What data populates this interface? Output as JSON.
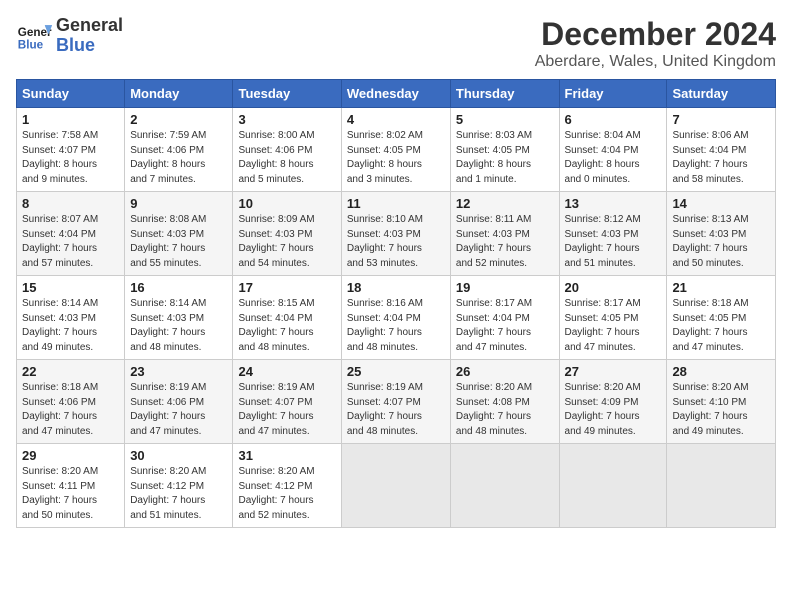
{
  "header": {
    "logo_line1": "General",
    "logo_line2": "Blue",
    "month": "December 2024",
    "location": "Aberdare, Wales, United Kingdom"
  },
  "weekdays": [
    "Sunday",
    "Monday",
    "Tuesday",
    "Wednesday",
    "Thursday",
    "Friday",
    "Saturday"
  ],
  "weeks": [
    [
      {
        "day": "1",
        "info": "Sunrise: 7:58 AM\nSunset: 4:07 PM\nDaylight: 8 hours\nand 9 minutes."
      },
      {
        "day": "2",
        "info": "Sunrise: 7:59 AM\nSunset: 4:06 PM\nDaylight: 8 hours\nand 7 minutes."
      },
      {
        "day": "3",
        "info": "Sunrise: 8:00 AM\nSunset: 4:06 PM\nDaylight: 8 hours\nand 5 minutes."
      },
      {
        "day": "4",
        "info": "Sunrise: 8:02 AM\nSunset: 4:05 PM\nDaylight: 8 hours\nand 3 minutes."
      },
      {
        "day": "5",
        "info": "Sunrise: 8:03 AM\nSunset: 4:05 PM\nDaylight: 8 hours\nand 1 minute."
      },
      {
        "day": "6",
        "info": "Sunrise: 8:04 AM\nSunset: 4:04 PM\nDaylight: 8 hours\nand 0 minutes."
      },
      {
        "day": "7",
        "info": "Sunrise: 8:06 AM\nSunset: 4:04 PM\nDaylight: 7 hours\nand 58 minutes."
      }
    ],
    [
      {
        "day": "8",
        "info": "Sunrise: 8:07 AM\nSunset: 4:04 PM\nDaylight: 7 hours\nand 57 minutes."
      },
      {
        "day": "9",
        "info": "Sunrise: 8:08 AM\nSunset: 4:03 PM\nDaylight: 7 hours\nand 55 minutes."
      },
      {
        "day": "10",
        "info": "Sunrise: 8:09 AM\nSunset: 4:03 PM\nDaylight: 7 hours\nand 54 minutes."
      },
      {
        "day": "11",
        "info": "Sunrise: 8:10 AM\nSunset: 4:03 PM\nDaylight: 7 hours\nand 53 minutes."
      },
      {
        "day": "12",
        "info": "Sunrise: 8:11 AM\nSunset: 4:03 PM\nDaylight: 7 hours\nand 52 minutes."
      },
      {
        "day": "13",
        "info": "Sunrise: 8:12 AM\nSunset: 4:03 PM\nDaylight: 7 hours\nand 51 minutes."
      },
      {
        "day": "14",
        "info": "Sunrise: 8:13 AM\nSunset: 4:03 PM\nDaylight: 7 hours\nand 50 minutes."
      }
    ],
    [
      {
        "day": "15",
        "info": "Sunrise: 8:14 AM\nSunset: 4:03 PM\nDaylight: 7 hours\nand 49 minutes."
      },
      {
        "day": "16",
        "info": "Sunrise: 8:14 AM\nSunset: 4:03 PM\nDaylight: 7 hours\nand 48 minutes."
      },
      {
        "day": "17",
        "info": "Sunrise: 8:15 AM\nSunset: 4:04 PM\nDaylight: 7 hours\nand 48 minutes."
      },
      {
        "day": "18",
        "info": "Sunrise: 8:16 AM\nSunset: 4:04 PM\nDaylight: 7 hours\nand 48 minutes."
      },
      {
        "day": "19",
        "info": "Sunrise: 8:17 AM\nSunset: 4:04 PM\nDaylight: 7 hours\nand 47 minutes."
      },
      {
        "day": "20",
        "info": "Sunrise: 8:17 AM\nSunset: 4:05 PM\nDaylight: 7 hours\nand 47 minutes."
      },
      {
        "day": "21",
        "info": "Sunrise: 8:18 AM\nSunset: 4:05 PM\nDaylight: 7 hours\nand 47 minutes."
      }
    ],
    [
      {
        "day": "22",
        "info": "Sunrise: 8:18 AM\nSunset: 4:06 PM\nDaylight: 7 hours\nand 47 minutes."
      },
      {
        "day": "23",
        "info": "Sunrise: 8:19 AM\nSunset: 4:06 PM\nDaylight: 7 hours\nand 47 minutes."
      },
      {
        "day": "24",
        "info": "Sunrise: 8:19 AM\nSunset: 4:07 PM\nDaylight: 7 hours\nand 47 minutes."
      },
      {
        "day": "25",
        "info": "Sunrise: 8:19 AM\nSunset: 4:07 PM\nDaylight: 7 hours\nand 48 minutes."
      },
      {
        "day": "26",
        "info": "Sunrise: 8:20 AM\nSunset: 4:08 PM\nDaylight: 7 hours\nand 48 minutes."
      },
      {
        "day": "27",
        "info": "Sunrise: 8:20 AM\nSunset: 4:09 PM\nDaylight: 7 hours\nand 49 minutes."
      },
      {
        "day": "28",
        "info": "Sunrise: 8:20 AM\nSunset: 4:10 PM\nDaylight: 7 hours\nand 49 minutes."
      }
    ],
    [
      {
        "day": "29",
        "info": "Sunrise: 8:20 AM\nSunset: 4:11 PM\nDaylight: 7 hours\nand 50 minutes."
      },
      {
        "day": "30",
        "info": "Sunrise: 8:20 AM\nSunset: 4:12 PM\nDaylight: 7 hours\nand 51 minutes."
      },
      {
        "day": "31",
        "info": "Sunrise: 8:20 AM\nSunset: 4:12 PM\nDaylight: 7 hours\nand 52 minutes."
      },
      {
        "day": "",
        "info": ""
      },
      {
        "day": "",
        "info": ""
      },
      {
        "day": "",
        "info": ""
      },
      {
        "day": "",
        "info": ""
      }
    ]
  ]
}
